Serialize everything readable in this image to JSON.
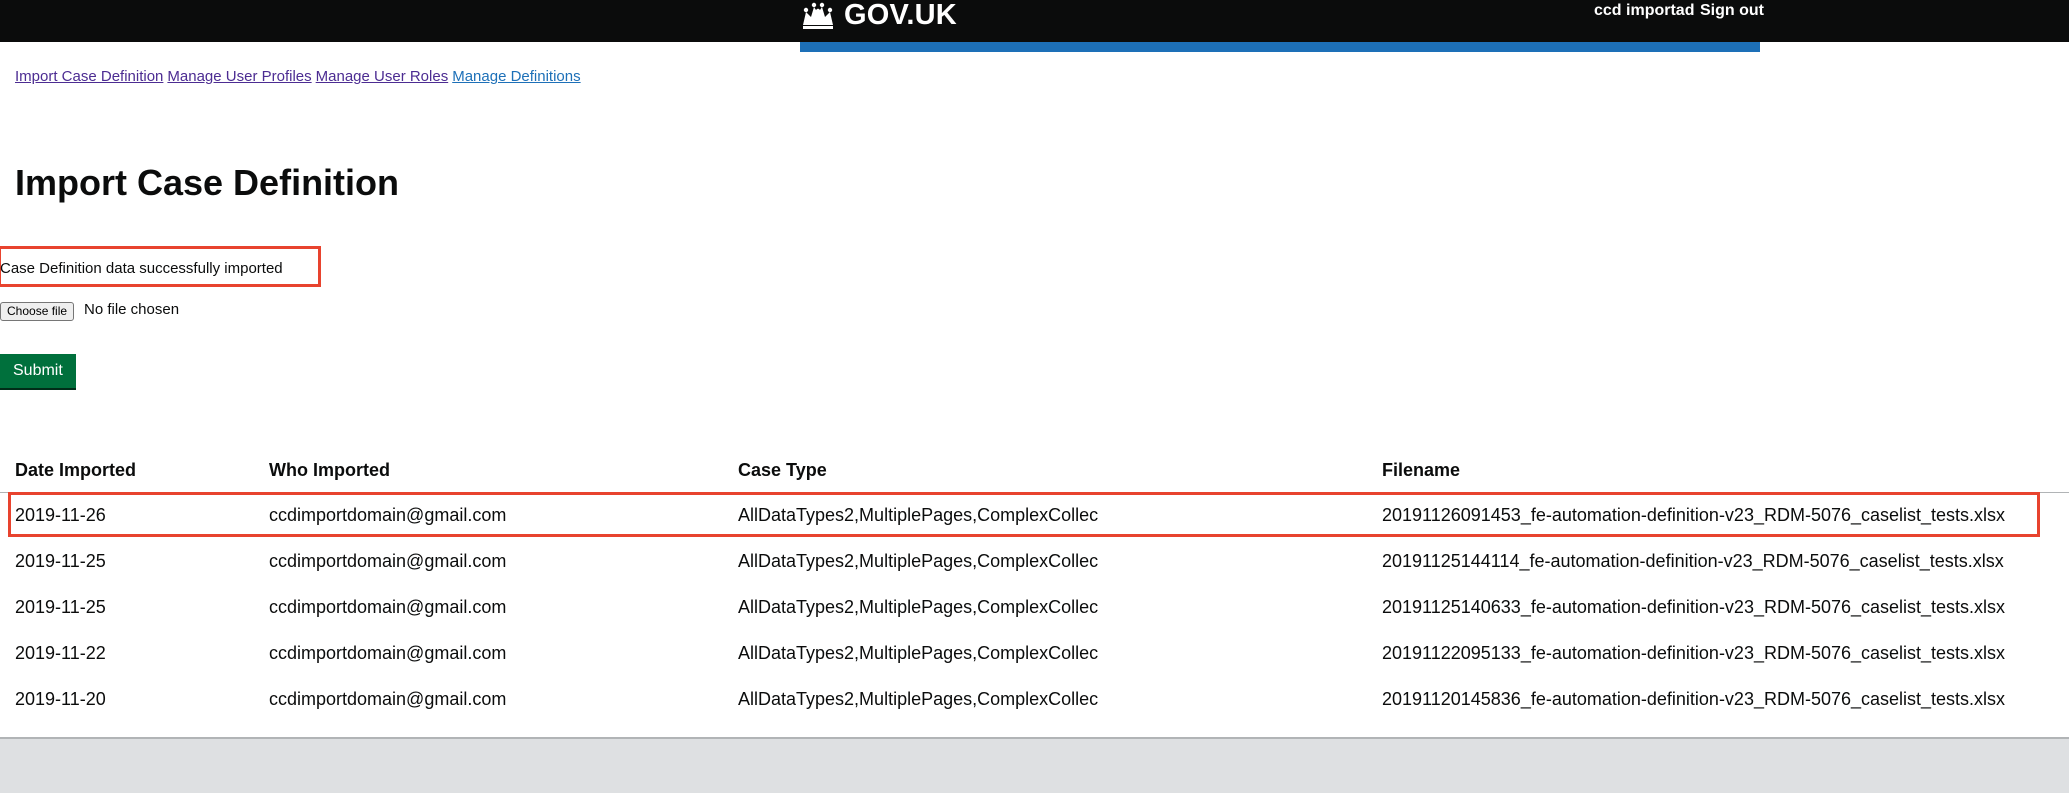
{
  "header": {
    "brand": "GOV.UK",
    "brand_icon": "crown-icon",
    "user_name": "ccd importad",
    "sign_out_label": "Sign out",
    "colors": {
      "bar": "#0b0c0c",
      "strip": "#1d70b8"
    }
  },
  "nav": {
    "items": [
      {
        "label": "Import Case Definition"
      },
      {
        "label": "Manage User Profiles"
      },
      {
        "label": "Manage User Roles"
      },
      {
        "label": "Manage Definitions"
      }
    ]
  },
  "page": {
    "title": "Import Case Definition"
  },
  "upload": {
    "success_message": "Case Definition data successfully imported",
    "choose_file_label": "Choose file",
    "file_status": "No file chosen",
    "submit_label": "Submit"
  },
  "table": {
    "headers": [
      "Date Imported",
      "Who Imported",
      "Case Type",
      "Filename"
    ],
    "rows": [
      [
        "2019-11-26",
        "ccdimportdomain@gmail.com",
        "AllDataTypes2,MultiplePages,ComplexCollec",
        "20191126091453_fe-automation-definition-v23_RDM-5076_caselist_tests.xlsx"
      ],
      [
        "2019-11-25",
        "ccdimportdomain@gmail.com",
        "AllDataTypes2,MultiplePages,ComplexCollec",
        "20191125144114_fe-automation-definition-v23_RDM-5076_caselist_tests.xlsx"
      ],
      [
        "2019-11-25",
        "ccdimportdomain@gmail.com",
        "AllDataTypes2,MultiplePages,ComplexCollec",
        "20191125140633_fe-automation-definition-v23_RDM-5076_caselist_tests.xlsx"
      ],
      [
        "2019-11-22",
        "ccdimportdomain@gmail.com",
        "AllDataTypes2,MultiplePages,ComplexCollec",
        "20191122095133_fe-automation-definition-v23_RDM-5076_caselist_tests.xlsx"
      ],
      [
        "2019-11-20",
        "ccdimportdomain@gmail.com",
        "AllDataTypes2,MultiplePages,ComplexCollec",
        "20191120145836_fe-automation-definition-v23_RDM-5076_caselist_tests.xlsx"
      ]
    ]
  },
  "colors": {
    "highlight": "#e8432e",
    "submit": "#00703c",
    "footer": "#dee0e2"
  }
}
